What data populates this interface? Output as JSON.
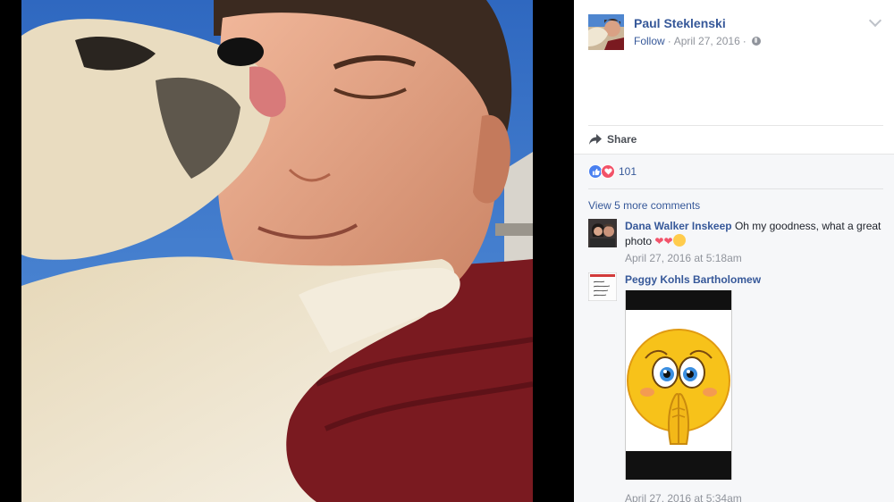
{
  "post": {
    "author": "Paul Steklenski",
    "follow_label": "Follow",
    "date": "April 27, 2016",
    "meta_separator": "·"
  },
  "actions": {
    "share_label": "Share"
  },
  "reactions": {
    "count": "101",
    "types": [
      "like-icon",
      "love-icon"
    ]
  },
  "comments": {
    "view_more_label": "View 5 more comments",
    "items": [
      {
        "author": "Dana Walker Inskeep",
        "text": "Oh my goodness, what a great photo",
        "emoji": [
          "heart",
          "heart",
          "smile"
        ],
        "time": "April 27, 2016 at 5:18am"
      },
      {
        "author": "Peggy Kohls Bartholomew",
        "text": "",
        "sticker": "praying-emoji-sticker",
        "time": "April 27, 2016 at 5:34am"
      }
    ]
  },
  "colors": {
    "link": "#365899",
    "meta": "#90949c",
    "like": "#4a80f0",
    "love": "#f25268",
    "sky": "#3a78c8",
    "sweater": "#7a1a20"
  }
}
